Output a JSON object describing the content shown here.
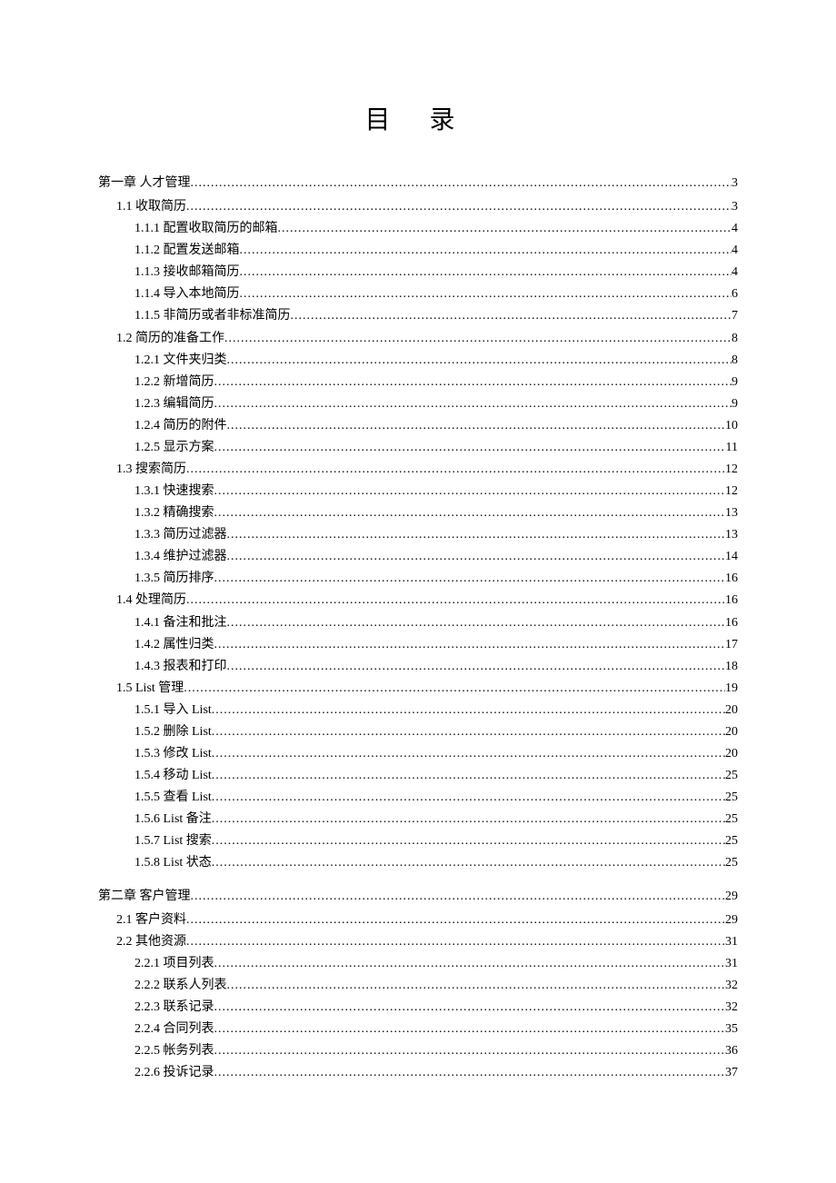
{
  "title": "目 录",
  "entries": [
    {
      "indent": 0,
      "label": "第一章 人才管理",
      "page": "3"
    },
    {
      "indent": 1,
      "label": "1.1 收取简历",
      "page": "3"
    },
    {
      "indent": 2,
      "label": "1.1.1 配置收取简历的邮箱",
      "page": "4"
    },
    {
      "indent": 2,
      "label": "1.1.2 配置发送邮箱",
      "page": "4"
    },
    {
      "indent": 2,
      "label": "1.1.3 接收邮箱简历",
      "page": "4"
    },
    {
      "indent": 2,
      "label": "1.1.4 导入本地简历",
      "page": "6"
    },
    {
      "indent": 2,
      "label": "1.1.5 非简历或者非标准简历",
      "page": "7"
    },
    {
      "indent": 1,
      "label": "1.2 简历的准备工作",
      "page": "8"
    },
    {
      "indent": 2,
      "label": "1.2.1 文件夹归类",
      "page": "8"
    },
    {
      "indent": 2,
      "label": "1.2.2 新增简历",
      "page": "9"
    },
    {
      "indent": 2,
      "label": "1.2.3 编辑简历",
      "page": "9"
    },
    {
      "indent": 2,
      "label": "1.2.4 简历的附件",
      "page": "10"
    },
    {
      "indent": 2,
      "label": "1.2.5 显示方案",
      "page": "11"
    },
    {
      "indent": 1,
      "label": "1.3 搜索简历",
      "page": "12"
    },
    {
      "indent": 2,
      "label": "1.3.1 快速搜索",
      "page": "12"
    },
    {
      "indent": 2,
      "label": "1.3.2 精确搜索",
      "page": "13"
    },
    {
      "indent": 2,
      "label": "1.3.3 简历过滤器",
      "page": "13"
    },
    {
      "indent": 2,
      "label": "1.3.4 维护过滤器",
      "page": "14"
    },
    {
      "indent": 2,
      "label": "1.3.5 简历排序",
      "page": "16"
    },
    {
      "indent": 1,
      "label": "1.4 处理简历",
      "page": "16"
    },
    {
      "indent": 2,
      "label": "1.4.1 备注和批注",
      "page": "16"
    },
    {
      "indent": 2,
      "label": "1.4.2 属性归类",
      "page": "17"
    },
    {
      "indent": 2,
      "label": "1.4.3 报表和打印",
      "page": "18"
    },
    {
      "indent": 1,
      "label": "1.5 List 管理",
      "page": "19"
    },
    {
      "indent": 2,
      "label": "1.5.1 导入 List",
      "page": "20"
    },
    {
      "indent": 2,
      "label": "1.5.2 删除 List",
      "page": "20"
    },
    {
      "indent": 2,
      "label": "1.5.3 修改 List",
      "page": "20"
    },
    {
      "indent": 2,
      "label": "1.5.4 移动 List",
      "page": "25"
    },
    {
      "indent": 2,
      "label": "1.5.5 查看 List",
      "page": "25"
    },
    {
      "indent": 2,
      "label": "1.5.6 List 备注",
      "page": "25"
    },
    {
      "indent": 2,
      "label": "1.5.7 List 搜索",
      "page": "25"
    },
    {
      "indent": 2,
      "label": "1.5.8 List 状态",
      "page": "25"
    },
    {
      "indent": 0,
      "label": "第二章 客户管理",
      "page": "29"
    },
    {
      "indent": 1,
      "label": "2.1 客户资料",
      "page": "29"
    },
    {
      "indent": 1,
      "label": "2.2 其他资源",
      "page": "31"
    },
    {
      "indent": 2,
      "label": "2.2.1 项目列表",
      "page": "31"
    },
    {
      "indent": 2,
      "label": "2.2.2 联系人列表",
      "page": "32"
    },
    {
      "indent": 2,
      "label": "2.2.3 联系记录",
      "page": "32"
    },
    {
      "indent": 2,
      "label": "2.2.4 合同列表",
      "page": "35"
    },
    {
      "indent": 2,
      "label": "2.2.5 帐务列表",
      "page": "36"
    },
    {
      "indent": 2,
      "label": "2.2.6 投诉记录",
      "page": "37"
    }
  ]
}
